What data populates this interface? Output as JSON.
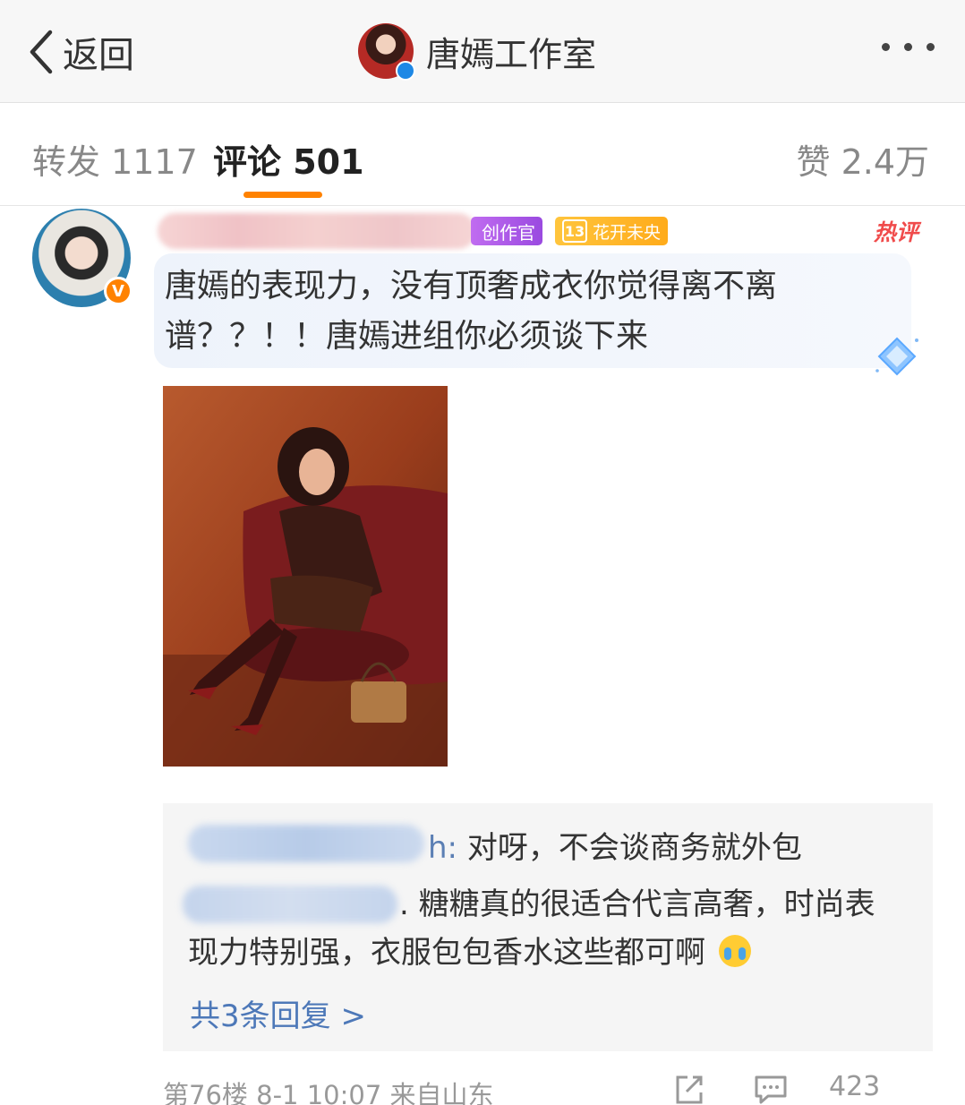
{
  "nav": {
    "back_label": "返回",
    "title": "唐嫣工作室"
  },
  "tabs": {
    "repost": "转发 1117",
    "comment": "评论 501",
    "like": "赞 2.4万"
  },
  "comment": {
    "badges": {
      "creator": "创作官",
      "fan_level": "13",
      "fan_club": "花开未央"
    },
    "hot_tag": "热评",
    "text": "唐嫣的表现力，没有顶奢成衣你觉得离不离谱？？！！唐嫣进组你必须谈下来",
    "replies": {
      "line1_tail": "h:",
      "line1": "对呀，不会谈商务就外包",
      "line2_prefix": ".",
      "line2": "糖糖真的很适合代言高奢，时尚表现力特别强，衣服包包香水这些都可啊",
      "more": "共3条回复 >"
    },
    "meta": "第76楼 8-1 10:07 来自山东",
    "like_count": "423"
  },
  "colors": {
    "accent": "#ff8200",
    "link": "#4d78b8",
    "hot": "#f04b4b"
  }
}
